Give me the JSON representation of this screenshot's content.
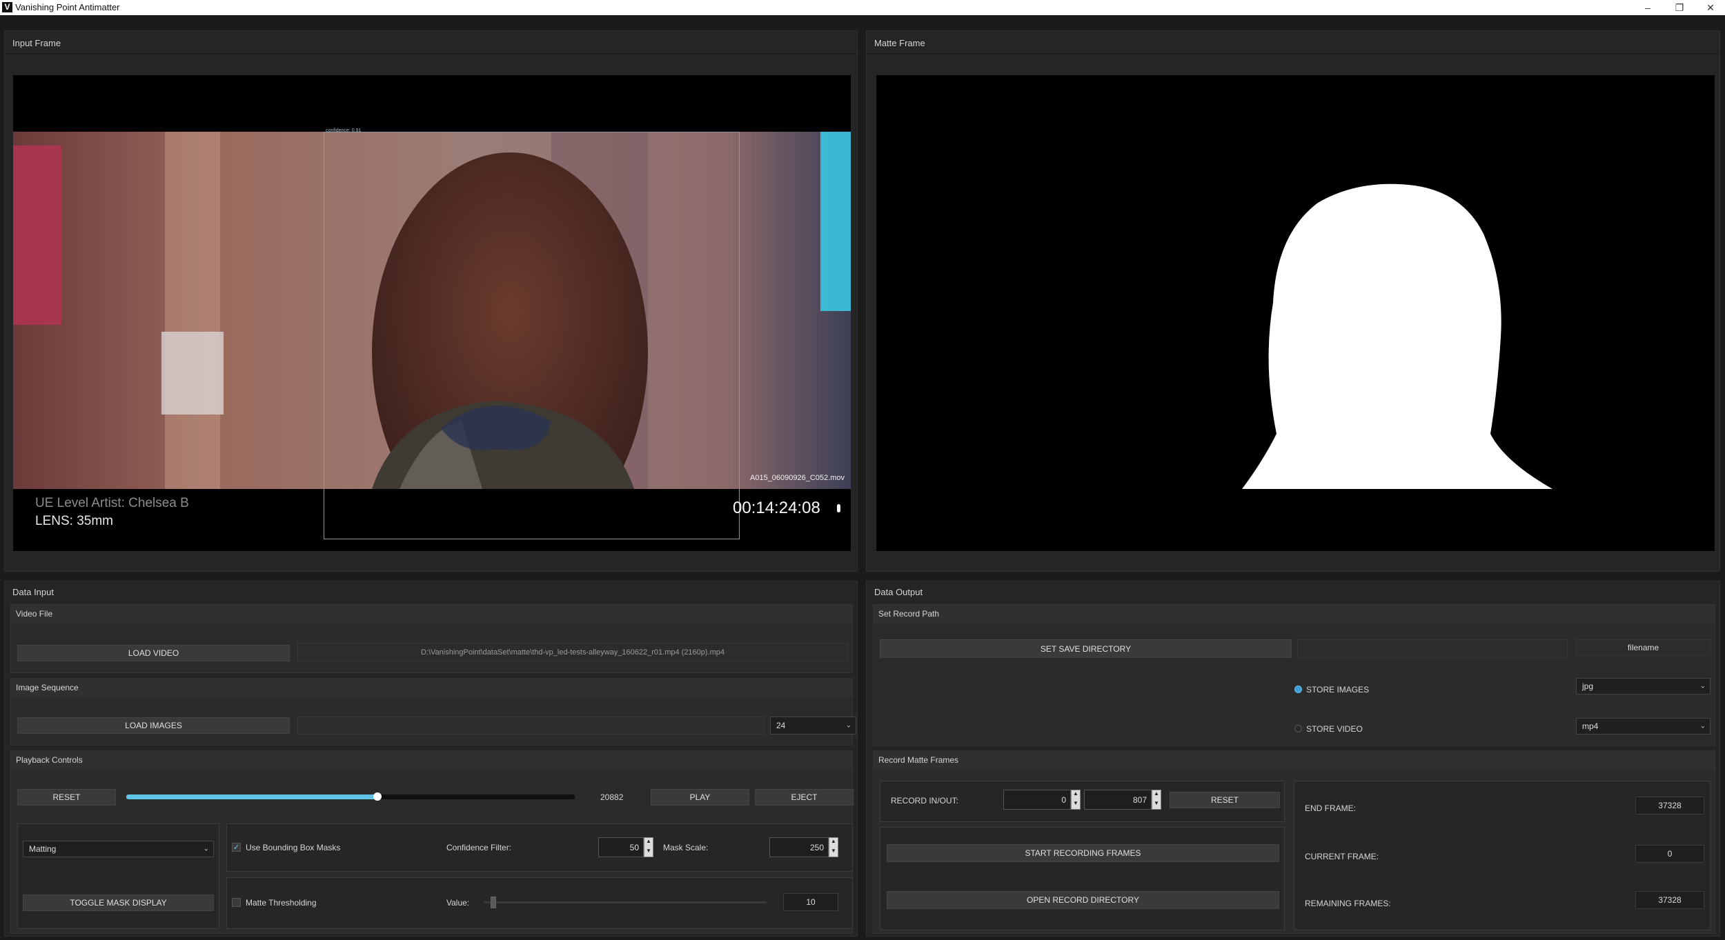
{
  "window": {
    "title": "Vanishing Point Antimatter",
    "logo": "V",
    "minimize": "–",
    "restore": "❐",
    "close": "✕"
  },
  "input_frame": {
    "title": "Input Frame",
    "filename_overlay": "A015_06090926_C052.mov",
    "confidence_label": "confidence: 0.91",
    "artist_text": "UE Level Artist: Chelsea B",
    "lens_text": "LENS: 35mm",
    "timecode": "00:14:24:08"
  },
  "matte_frame": {
    "title": "Matte Frame"
  },
  "data_input": {
    "title": "Data Input",
    "video_file": {
      "header": "Video File",
      "load_label": "LOAD VIDEO",
      "path": "D:\\VanishingPoint\\dataSet\\matte\\thd-vp_led-tests-alleyway_160622_r01.mp4 (2160p).mp4"
    },
    "image_sequence": {
      "header": "Image Sequence",
      "load_label": "LOAD IMAGES",
      "path": "",
      "fps": "24"
    },
    "playback": {
      "header": "Playback Controls",
      "reset_label": "RESET",
      "frame_value": "20882",
      "slider_fraction": 0.56,
      "play_label": "PLAY",
      "eject_label": "EJECT",
      "mode_selected": "Matting",
      "toggle_mask_label": "TOGGLE MASK DISPLAY",
      "use_bbox_label": "Use Bounding Box Masks",
      "use_bbox_checked": true,
      "confidence_label": "Confidence Filter:",
      "confidence_value": "50",
      "mask_scale_label": "Mask Scale:",
      "mask_scale_value": "250",
      "matte_threshold_label": "Matte Thresholding",
      "matte_threshold_checked": false,
      "value_label": "Value:",
      "value_value": "10"
    }
  },
  "data_output": {
    "title": "Data Output",
    "record_path": {
      "header": "Set Record Path",
      "set_dir_label": "SET SAVE DIRECTORY",
      "dir_value": "",
      "filename_value": "filename",
      "store_images_label": "STORE IMAGES",
      "store_images_checked": true,
      "image_format": "jpg",
      "store_video_label": "STORE VIDEO",
      "store_video_checked": false,
      "video_format": "mp4"
    },
    "record_frames": {
      "header": "Record Matte Frames",
      "in_out_label": "RECORD IN/OUT:",
      "in_value": "0",
      "out_value": "807",
      "reset_label": "RESET",
      "start_label": "START RECORDING FRAMES",
      "open_dir_label": "OPEN RECORD DIRECTORY",
      "end_frame_label": "END FRAME:",
      "end_frame_value": "37328",
      "current_frame_label": "CURRENT FRAME:",
      "current_frame_value": "0",
      "remaining_label": "REMAINING FRAMES:",
      "remaining_value": "37328"
    }
  },
  "colors": {
    "accent": "#3aa0d6",
    "slider_fill": "#5ec4e6",
    "panel_bg": "#252525"
  }
}
